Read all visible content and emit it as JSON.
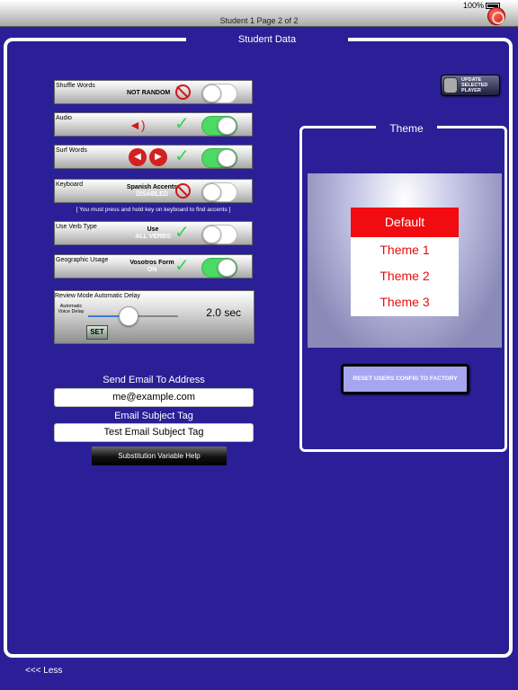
{
  "status": {
    "battery": "100%"
  },
  "topbar": {
    "title": "Student 1 Page 2 of 2"
  },
  "main": {
    "title": "Student Data"
  },
  "settings": [
    {
      "label": "Shuffle Words",
      "value_line1": "NOT RANDOM",
      "value_line2": "",
      "indicator": "prohibited-icon",
      "toggle": "off"
    },
    {
      "label": "Audio",
      "value_line1": "",
      "value_line2": "",
      "indicator": "check-icon",
      "toggle": "on"
    },
    {
      "label": "Surf Words",
      "value_line1": "",
      "value_line2": "",
      "indicator": "check-icon",
      "toggle": "on"
    },
    {
      "label": "Keyboard",
      "value_line1": "Spanish Accents",
      "value_line2": "DISABLED",
      "indicator": "prohibited-icon",
      "toggle": "off"
    },
    {
      "label": "Use Verb Type",
      "value_line1": "Use",
      "value_line2": "ALL VERBS",
      "indicator": "check-icon",
      "toggle": "off"
    },
    {
      "label": "Geographic Usage",
      "value_line1": "Vosotros Form",
      "value_line2": "ON",
      "indicator": "check-icon",
      "toggle": "on"
    }
  ],
  "keyboard_hint": "[ You must press and hold key on keyboard to find accents ]",
  "delay": {
    "label": "Review Mode Automatic Delay",
    "sub_label": "Automatic Voice Delay",
    "value": "2.0 sec",
    "slider_fraction": 0.4,
    "set_label": "SET"
  },
  "email": {
    "address_label": "Send Email To Address",
    "address_value": "me@example.com",
    "subject_label": "Email Subject Tag",
    "subject_value": "Test Email Subject Tag",
    "help_button": "Substitution Variable Help"
  },
  "update_button": {
    "line1": "UPDATE",
    "line2": "SELECTED",
    "line3": "PLAYER"
  },
  "theme": {
    "title": "Theme",
    "options": [
      "Default",
      "Theme 1",
      "Theme 2",
      "Theme 3"
    ],
    "selected": "Default",
    "reset_button": "RESET USERS CONFIG TO FACTORY"
  },
  "footer": {
    "less_link": "<<< Less"
  },
  "colors": {
    "background": "#2a1f96",
    "accent_red": "#f00c10",
    "toggle_on": "#4cd964"
  }
}
